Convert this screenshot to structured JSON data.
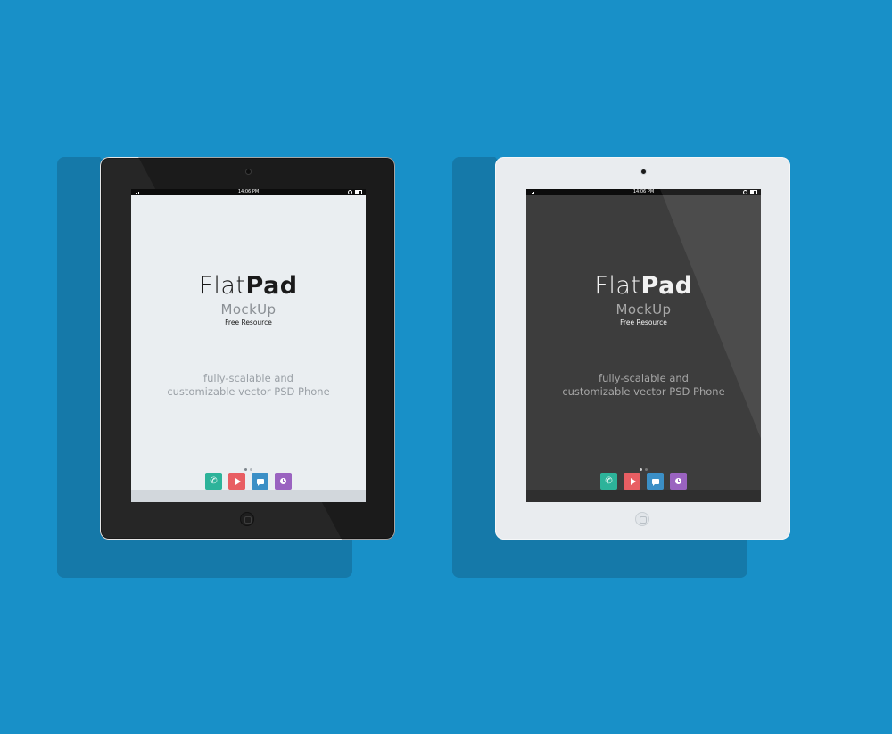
{
  "colors": {
    "background": "#1890c8",
    "shadow": "#1579a9",
    "phone_app": "#2db39a",
    "play_app": "#e85e63",
    "chat_app": "#3b8fc6",
    "clock_app": "#9a63c0"
  },
  "devices": [
    {
      "variant": "black",
      "status_time": "14:06 PM",
      "title_light": "Flat",
      "title_bold": "Pad",
      "subtitle": "MockUp",
      "resource": "Free Resource",
      "desc_line1": "fully-scalable and",
      "desc_line2": "customizable vector PSD Phone",
      "dock_apps": [
        "phone-icon",
        "play-icon",
        "chat-icon",
        "clock-icon"
      ]
    },
    {
      "variant": "white",
      "status_time": "14:06 PM",
      "title_light": "Flat",
      "title_bold": "Pad",
      "subtitle": "MockUp",
      "resource": "Free Resource",
      "desc_line1": "fully-scalable and",
      "desc_line2": "customizable vector PSD Phone",
      "dock_apps": [
        "phone-icon",
        "play-icon",
        "chat-icon",
        "clock-icon"
      ]
    }
  ]
}
